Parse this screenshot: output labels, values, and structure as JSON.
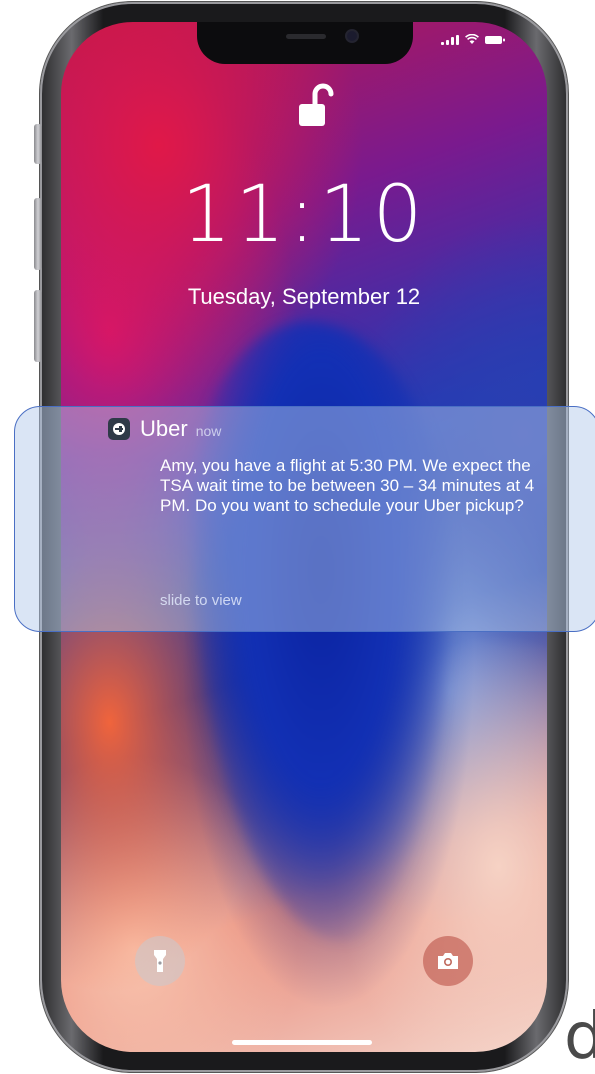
{
  "lock_screen": {
    "time": "11:10",
    "date": "Tuesday, September 12"
  },
  "status_bar": {
    "icons": [
      "signal-icon",
      "wifi-icon",
      "battery-icon"
    ]
  },
  "notification": {
    "app_name": "Uber",
    "timestamp": "now",
    "message": "Amy, you have a flight at 5:30 PM. We expect the TSA wait time to be between 30 – 34 minutes at 4 PM. Do you want to schedule your Uber pickup?",
    "hint": "slide to view"
  },
  "quick_actions": {
    "left_icon": "flashlight-icon",
    "right_icon": "camera-icon"
  },
  "edge_text": "d",
  "colors": {
    "notification_border": "#4a6fc4",
    "wallpaper_blue": "#0c2a9a",
    "wallpaper_red": "#e01848"
  }
}
